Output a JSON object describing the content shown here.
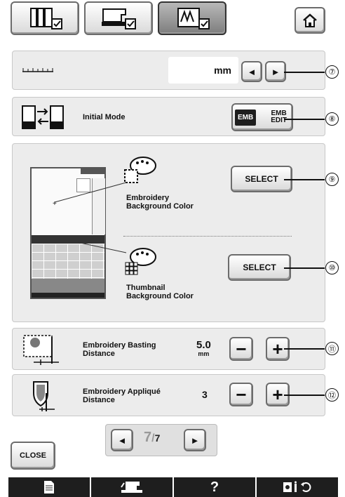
{
  "top_toolbar": {
    "tabs": [
      {
        "icon": "utility-settings-icon"
      },
      {
        "icon": "sewing-machine-settings-icon"
      },
      {
        "icon": "embroidery-settings-icon"
      }
    ],
    "home_icon": "home-icon"
  },
  "unit_row": {
    "value": "mm",
    "left_arrow": "◄",
    "right_arrow": "►",
    "callout": "⑦"
  },
  "initial_mode_row": {
    "label": "Initial Mode",
    "emb_label": "EMB",
    "embedit_label_line1": "EMB",
    "embedit_label_line2": "EDIT",
    "callout": "⑧"
  },
  "background_panel": {
    "embroidery_bg_label_line1": "Embroidery",
    "embroidery_bg_label_line2": "Background Color",
    "embroidery_select": "SELECT",
    "embroidery_callout": "⑨",
    "thumbnail_bg_label_line1": "Thumbnail",
    "thumbnail_bg_label_line2": "Background Color",
    "thumbnail_select": "SELECT",
    "thumbnail_callout": "⑩"
  },
  "basting_row": {
    "label_line1": "Embroidery Basting",
    "label_line2": "Distance",
    "value": "5.0",
    "unit": "mm",
    "minus": "−",
    "plus": "+",
    "callout": "⑪"
  },
  "applique_row": {
    "label_line1": "Embroidery Appliqué",
    "label_line2": "Distance",
    "value": "3",
    "minus": "−",
    "plus": "+",
    "callout": "⑫"
  },
  "pagination": {
    "prev": "◄",
    "current": "7",
    "total": "7",
    "next": "►"
  },
  "close_label": "CLOSE",
  "bottom_bar": {
    "help_label": "?"
  }
}
